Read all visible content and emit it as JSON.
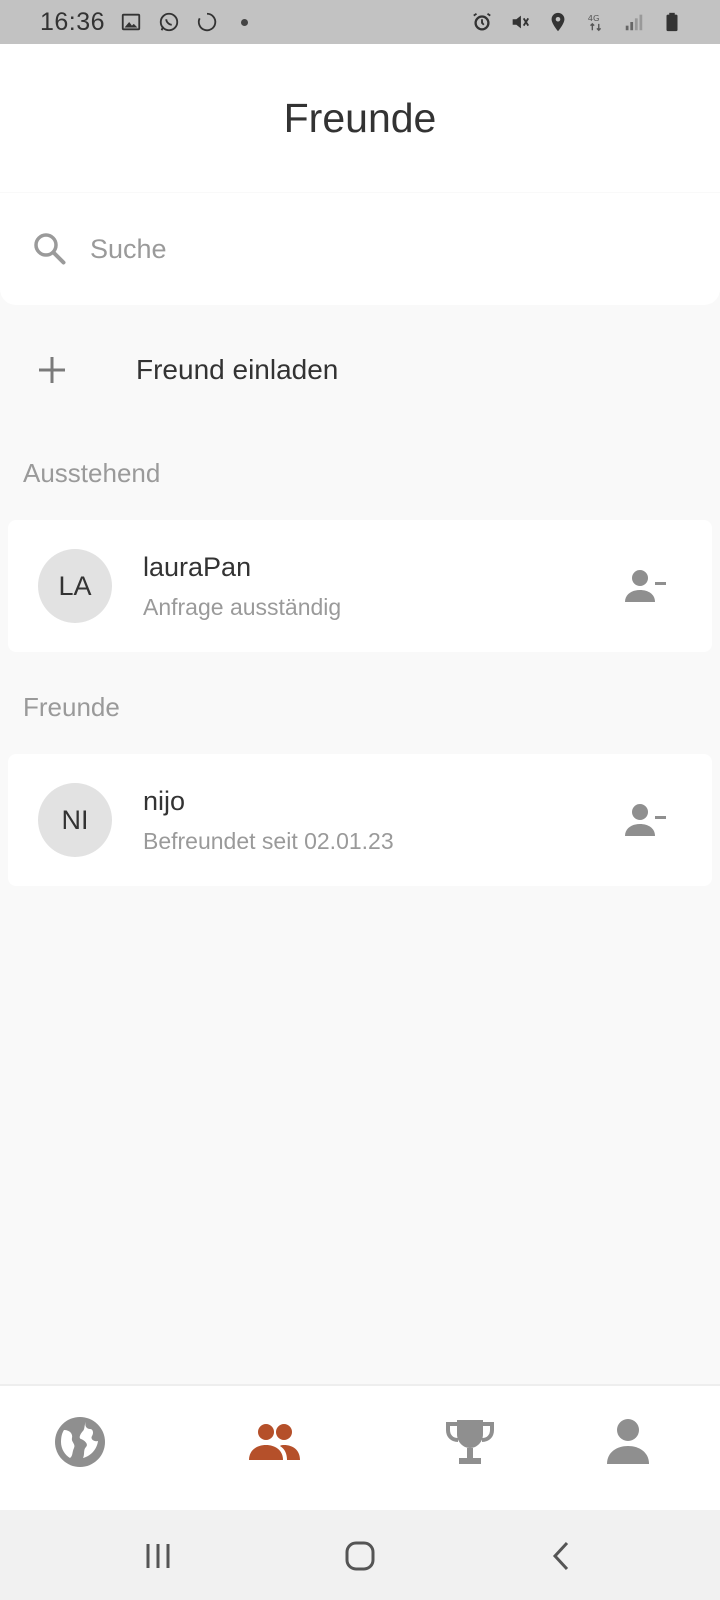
{
  "status_bar": {
    "time": "16:36",
    "left_icons": [
      "gallery-icon",
      "whatsapp-icon",
      "sync-circle-icon",
      "dot-icon"
    ],
    "right_icons": [
      "alarm-icon",
      "mute-icon",
      "location-icon",
      "4g-data-icon",
      "signal-icon",
      "battery-icon"
    ],
    "network_label": "4G"
  },
  "header": {
    "title": "Freunde"
  },
  "search": {
    "placeholder": "Suche",
    "value": ""
  },
  "invite": {
    "label": "Freund einladen"
  },
  "sections": {
    "pending": {
      "label": "Ausstehend",
      "items": [
        {
          "initials": "LA",
          "name": "lauraPan",
          "subtitle": "Anfrage ausständig"
        }
      ]
    },
    "friends": {
      "label": "Freunde",
      "items": [
        {
          "initials": "NI",
          "name": "nijo",
          "subtitle": "Befreundet seit 02.01.23"
        }
      ]
    }
  },
  "bottom_nav": {
    "items": [
      {
        "icon": "globe-icon",
        "active": false
      },
      {
        "icon": "friends-icon",
        "active": true
      },
      {
        "icon": "trophy-icon",
        "active": false
      },
      {
        "icon": "profile-icon",
        "active": false
      }
    ],
    "active_color": "#b5502a",
    "inactive_color": "#8f8f8f"
  },
  "system_nav": {
    "buttons": [
      "recent-apps-icon",
      "home-icon",
      "back-icon"
    ]
  }
}
